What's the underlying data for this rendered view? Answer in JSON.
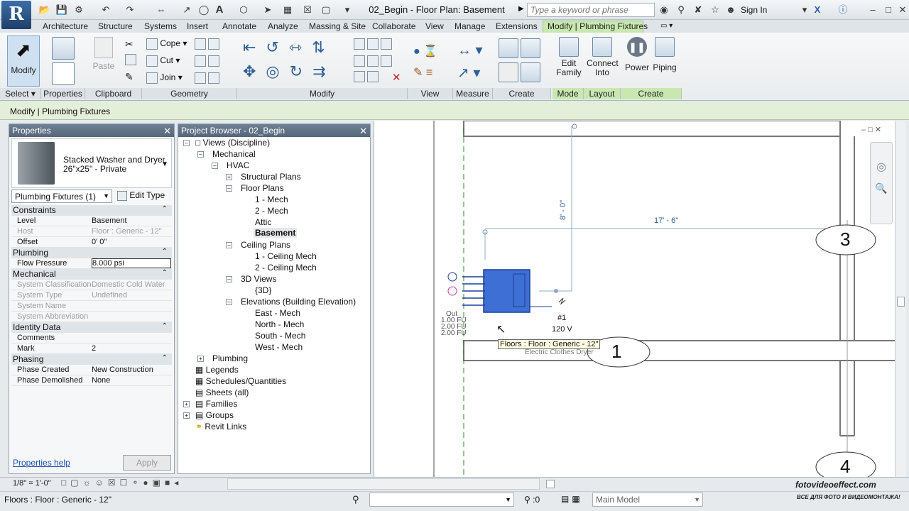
{
  "title_bar": {
    "document_title": "02_Begin - Floor Plan: Basement",
    "search_placeholder": "Type a keyword or phrase",
    "sign_in": "Sign In"
  },
  "ribbon": {
    "tabs": [
      "Architecture",
      "Structure",
      "Systems",
      "Insert",
      "Annotate",
      "Analyze",
      "Massing & Site",
      "Collaborate",
      "View",
      "Manage",
      "Extensions"
    ],
    "active_tab": "Modify | Plumbing Fixtures",
    "modify_label": "Modify",
    "properties_label": "Properties",
    "paste_label": "Paste",
    "cope_label": "Cope",
    "cut_label": "Cut",
    "join_label": "Join",
    "edit_family_label": "Edit Family",
    "connect_into_label": "Connect Into",
    "power_label": "Power",
    "piping_label": "Piping",
    "panels": {
      "select": "Select",
      "properties": "Properties",
      "clipboard": "Clipboard",
      "geometry": "Geometry",
      "modify": "Modify",
      "view": "View",
      "measure": "Measure",
      "create": "Create",
      "mode": "Mode",
      "layout": "Layout",
      "create_systems": "Create Systems"
    }
  },
  "options_bar": {
    "label": "Modify | Plumbing Fixtures"
  },
  "properties": {
    "title": "Properties",
    "type_name": "Stacked Washer and Dryer",
    "type_size": "26\"x25\" - Private",
    "filter": "Plumbing Fixtures (1)",
    "edit_type": "Edit Type",
    "groups": {
      "constraints": "Constraints",
      "plumbing": "Plumbing",
      "mechanical": "Mechanical",
      "identity": "Identity Data",
      "phasing": "Phasing"
    },
    "rows": {
      "level": {
        "k": "Level",
        "v": "Basement"
      },
      "host": {
        "k": "Host",
        "v": "Floor : Generic - 12\""
      },
      "offset": {
        "k": "Offset",
        "v": "0'  0\""
      },
      "flow_pressure": {
        "k": "Flow Pressure",
        "v": "8.000 psi"
      },
      "system_classification": {
        "k": "System Classification",
        "v": "Domestic Cold Water"
      },
      "system_type": {
        "k": "System Type",
        "v": "Undefined"
      },
      "system_name": {
        "k": "System Name",
        "v": ""
      },
      "system_abbreviation": {
        "k": "System Abbreviation",
        "v": ""
      },
      "comments": {
        "k": "Comments",
        "v": ""
      },
      "mark": {
        "k": "Mark",
        "v": "2"
      },
      "phase_created": {
        "k": "Phase Created",
        "v": "New Construction"
      },
      "phase_demolished": {
        "k": "Phase Demolished",
        "v": "None"
      }
    },
    "help_link": "Properties help",
    "apply": "Apply"
  },
  "browser": {
    "title": "Project Browser - 02_Begin",
    "nodes": {
      "views": "Views (Discipline)",
      "mechanical": "Mechanical",
      "hvac": "HVAC",
      "structural_plans": "Structural Plans",
      "floor_plans": "Floor Plans",
      "mech1": "1 - Mech",
      "mech2": "2 - Mech",
      "attic": "Attic",
      "basement": "Basement",
      "ceiling_plans": "Ceiling Plans",
      "ceil1": "1 - Ceiling Mech",
      "ceil2": "2 - Ceiling Mech",
      "views3d": "3D Views",
      "view3d": "{3D}",
      "elevations": "Elevations (Building Elevation)",
      "east": "East - Mech",
      "north": "North - Mech",
      "south": "South - Mech",
      "west": "West - Mech",
      "plumbing": "Plumbing",
      "legends": "Legends",
      "schedules": "Schedules/Quantities",
      "sheets": "Sheets (all)",
      "families": "Families",
      "groups": "Groups",
      "revit_links": "Revit Links"
    }
  },
  "drawing": {
    "dim_vertical": "8' - 0\"",
    "dim_horizontal": "17' - 6\"",
    "grid_3": "3",
    "grid_1": "1",
    "grid_4": "4",
    "circuit": "#1",
    "voltage": "120 V",
    "fixture_labels": [
      "Out",
      "1.00 FU",
      "2.00 FU",
      "2.00 FU"
    ],
    "tooltip": "Floors : Floor : Generic - 12\"",
    "tag": "Electric Clothes Dryer"
  },
  "view_bar": {
    "scale": "1/8\" = 1'-0\""
  },
  "status_bar": {
    "status": "Floors : Floor : Generic - 12\"",
    "selection_count": ":0",
    "model": "Main Model"
  },
  "watermark": {
    "site": "fotovideoeffect.com",
    "tagline": "ВСЕ ДЛЯ ФОТО И ВИДЕОМОНТАЖА!"
  }
}
